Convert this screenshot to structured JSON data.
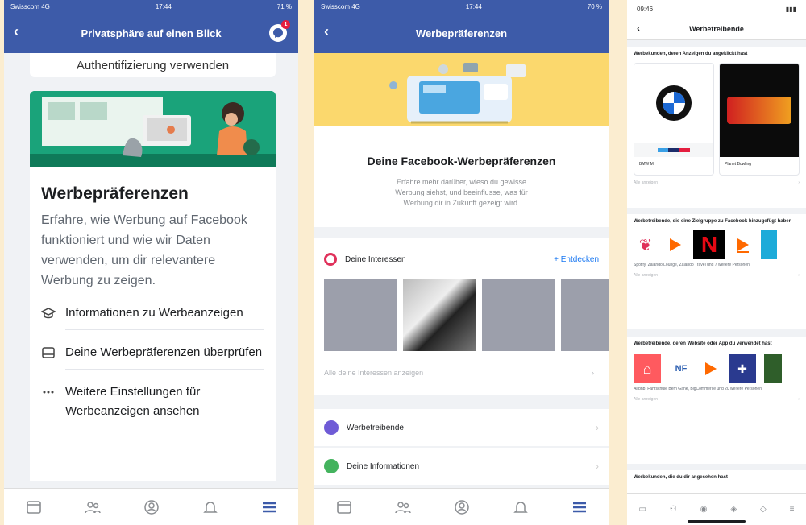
{
  "colors": {
    "fb_blue": "#3d5ba9",
    "green": "#19a077",
    "yellow": "#fbd86d",
    "link": "#1877f2",
    "bg": "#fbedd0"
  },
  "panel1": {
    "status": {
      "carrier": "Swisscom 4G",
      "time": "17:44",
      "battery": "71 %"
    },
    "header_title": "Privatsphäre auf einen Blick",
    "messenger_badge": "1",
    "prev_card_text": "Authentifizierung verwenden",
    "card": {
      "title": "Werbepräferenzen",
      "desc": "Erfahre, wie Werbung auf Facebook funktioniert und wie wir Daten verwenden, um dir relevantere Werbung zu zeigen.",
      "items": [
        {
          "icon": "graduation-cap-icon",
          "label": "Informationen zu Werbeanzeigen"
        },
        {
          "icon": "ad-preferences-icon",
          "label": "Deine Werbepräferenzen überprüfen"
        },
        {
          "icon": "more-dots-icon",
          "label": "Weitere Einstellungen für Werbeanzeigen ansehen"
        }
      ]
    },
    "tabs": [
      "news-feed-icon",
      "friends-icon",
      "profile-icon",
      "notifications-icon",
      "menu-icon"
    ]
  },
  "panel2": {
    "status": {
      "carrier": "Swisscom 4G",
      "time": "17:44",
      "battery": "70 %"
    },
    "header_title": "Werbepräferenzen",
    "intro_title": "Deine Facebook-Werbepräferenzen",
    "intro_text": "Erfahre mehr darüber, wieso du gewisse Werbung siehst, und beeinflusse, was für Werbung dir in Zukunft gezeigt wird.",
    "interests_label": "Deine Interessen",
    "discover_label": "+ Entdecken",
    "all_interests": "Alle deine Interessen anzeigen",
    "rows": [
      {
        "label": "Werbetreibende",
        "color": "#6f5bd6"
      },
      {
        "label": "Deine Informationen",
        "color": "#44b35e"
      }
    ]
  },
  "panel3": {
    "status": {
      "time": "09:46"
    },
    "header_title": "Werbetreibende",
    "sections": [
      {
        "title": "Werbekunden, deren Anzeigen du angeklickt hast",
        "cards": [
          "BMW M",
          "Planet Bowling"
        ],
        "more": "Alle anzeigen"
      },
      {
        "title": "Werbetreibende, die eine Zielgruppe zu Facebook hinzugefügt haben",
        "sub": "Spotify, Zalando Lounge, Zalando Travel und 7 weitere Personen",
        "more": "Alle anzeigen"
      },
      {
        "title": "Werbetreibende, deren Website oder App du verwendet hast",
        "sub": "Airbnb, Fahrschule Bern Gäne, BigCommerce und 20 weitere Personen",
        "more": "Alle anzeigen"
      },
      {
        "title": "Werbekunden, die du dir angesehen hast"
      }
    ]
  }
}
